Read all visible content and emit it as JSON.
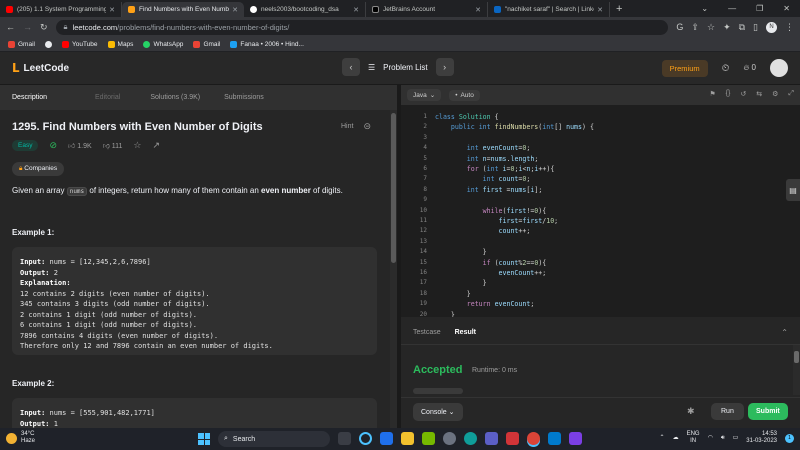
{
  "browser": {
    "tabs": [
      {
        "title": "(205) 1.1 System Programming h",
        "color": "#ff0000"
      },
      {
        "title": "Find Numbers with Even Number",
        "color": "#ffa116",
        "active": true
      },
      {
        "title": "neels2003/bootcoding_dsa",
        "color": "#ffffff"
      },
      {
        "title": "JetBrains Account",
        "color": "#000000"
      },
      {
        "title": "\"nachiket saraf\" | Search | Linked",
        "color": "#0a66c2"
      }
    ],
    "new_tab": "+",
    "url_domain": "leetcode.com",
    "url_path": "/problems/find-numbers-with-even-number-of-digits/",
    "profile_initial": "N",
    "bookmarks": [
      {
        "label": "Gmail",
        "color": "#ea4335"
      },
      {
        "label": "",
        "color": "#e8eaed"
      },
      {
        "label": "YouTube",
        "color": "#ff0000"
      },
      {
        "label": "Maps",
        "color": "#fbbc04"
      },
      {
        "label": "WhatsApp",
        "color": "#25d366"
      },
      {
        "label": "Gmail",
        "color": "#ea4335"
      },
      {
        "label": "Fanaa • 2006 • Hind...",
        "color": "#1da1f2"
      }
    ]
  },
  "lc": {
    "logo": "LeetCode",
    "problem_list": "Problem List",
    "premium": "Premium",
    "streak": "0"
  },
  "left": {
    "tabs": [
      "Description",
      "Editorial",
      "Solutions (3.9K)",
      "Submissions"
    ],
    "title": "1295. Find Numbers with Even Number of Digits",
    "hint": "Hint",
    "difficulty": "Easy",
    "likes": "1.9K",
    "dislikes": "111",
    "companies": "Companies",
    "desc_pre": "Given an array ",
    "desc_code": "nums",
    "desc_mid": " of integers, return how many of them contain an ",
    "desc_bold": "even number",
    "desc_post": " of digits.",
    "ex1_head": "Example 1:",
    "ex1_input_label": "Input:",
    "ex1_input": " nums = [12,345,2,6,7896]",
    "ex1_output_label": "Output:",
    "ex1_output": " 2",
    "ex1_expl_label": "Explanation:",
    "ex1_lines": [
      "12 contains 2 digits (even number of digits).",
      "345 contains 3 digits (odd number of digits).",
      "2 contains 1 digit (odd number of digits).",
      "6 contains 1 digit (odd number of digits).",
      "7896 contains 4 digits (even number of digits).",
      "Therefore only 12 and 7896 contain an even number of digits."
    ],
    "ex2_head": "Example 2:",
    "ex2_input_label": "Input:",
    "ex2_input": " nums = [555,901,482,1771]",
    "ex2_output_label": "Output:",
    "ex2_output": " 1"
  },
  "right": {
    "language": "Java",
    "mode": "Auto",
    "tab_testcase": "Testcase",
    "tab_result": "Result",
    "accepted": "Accepted",
    "runtime": "Runtime: 0 ms",
    "console": "Console",
    "run": "Run",
    "submit": "Submit"
  },
  "code_lines": [
    "1",
    "2",
    "3",
    "4",
    "5",
    "6",
    "7",
    "8",
    "9",
    "10",
    "11",
    "12",
    "13",
    "14",
    "15",
    "16",
    "17",
    "18",
    "19",
    "20"
  ],
  "taskbar": {
    "temp": "34°C",
    "weather": "Haze",
    "search": "Search",
    "lang": "ENG",
    "region": "IN",
    "time": "14:53",
    "date": "31-03-2023"
  }
}
